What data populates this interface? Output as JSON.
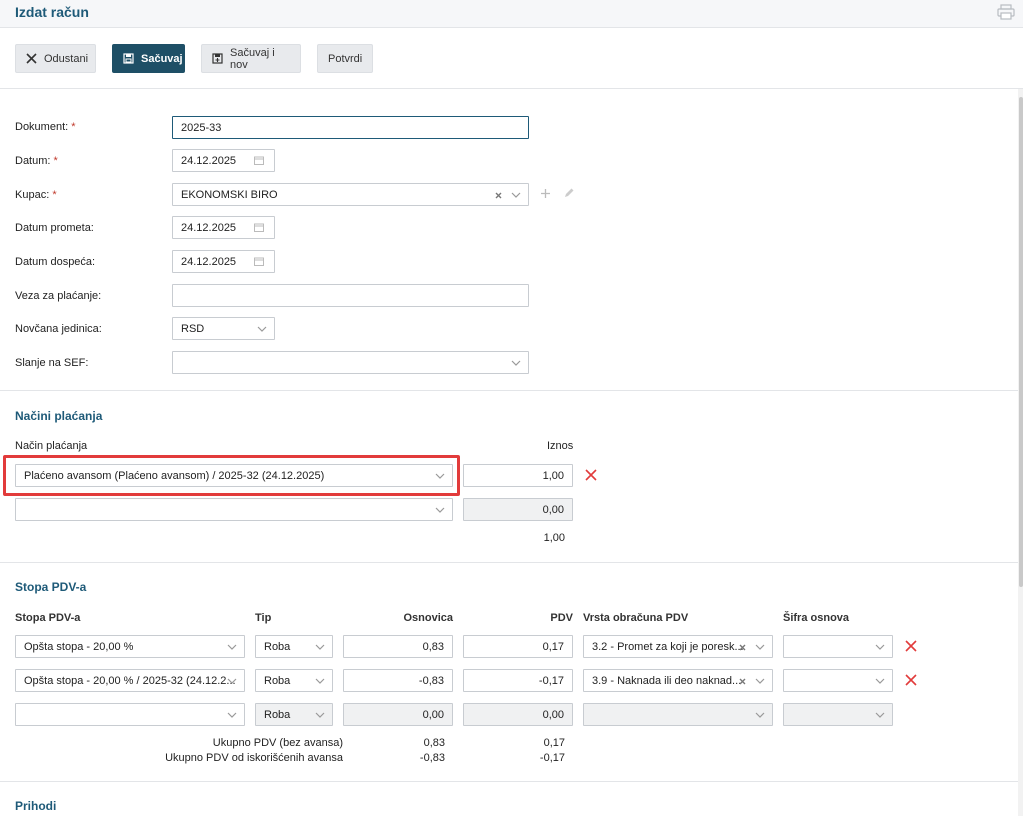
{
  "header": {
    "title": "Izdat račun"
  },
  "toolbar": {
    "cancel_label": "Odustani",
    "save_label": "Sačuvaj",
    "save_new_label": "Sačuvaj i nov",
    "confirm_label": "Potvrdi"
  },
  "form": {
    "dokument_label": "Dokument:",
    "dokument_value": "2025-33",
    "datum_label": "Datum:",
    "datum_value": "24.12.2025",
    "kupac_label": "Kupac:",
    "kupac_value": "EKONOMSKI BIRO",
    "datum_prometa_label": "Datum prometa:",
    "datum_prometa_value": "24.12.2025",
    "datum_dospeca_label": "Datum dospeća:",
    "datum_dospeca_value": "24.12.2025",
    "veza_label": "Veza za plaćanje:",
    "veza_value": "",
    "valuta_label": "Novčana jedinica:",
    "valuta_value": "RSD",
    "sef_label": "Slanje na SEF:",
    "sef_value": "",
    "required_mark": "*"
  },
  "payments": {
    "title": "Načini plaćanja",
    "col_method": "Način plaćanja",
    "col_amount": "Iznos",
    "rows": [
      {
        "method": "Plaćeno avansom (Plaćeno avansom) / 2025-32 (24.12.2025)",
        "amount": "1,00"
      },
      {
        "method": "",
        "amount": "0,00"
      }
    ],
    "total": "1,00"
  },
  "vat": {
    "title": "Stopa PDV-a",
    "col_rate": "Stopa PDV-a",
    "col_type": "Tip",
    "col_base": "Osnovica",
    "col_vat": "PDV",
    "col_calc": "Vrsta obračuna PDV",
    "col_code": "Šifra osnova",
    "rows": [
      {
        "rate": "Opšta stopa - 20,00 %",
        "type": "Roba",
        "base": "0,83",
        "vat": "0,17",
        "calc": "3.2 - Promet za koji je poresk...",
        "code": ""
      },
      {
        "rate": "Opšta stopa - 20,00 % / 2025-32 (24.12.2...",
        "type": "Roba",
        "base": "-0,83",
        "vat": "-0,17",
        "calc": "3.9 - Naknada ili deo naknad...",
        "code": ""
      },
      {
        "rate": "",
        "type": "Roba",
        "base": "0,00",
        "vat": "0,00",
        "calc": "",
        "code": ""
      }
    ],
    "sum1_label": "Ukupno PDV (bez avansa)",
    "sum1_base": "0,83",
    "sum1_vat": "0,17",
    "sum2_label": "Ukupno PDV od iskorišćenih avansa",
    "sum2_base": "-0,83",
    "sum2_vat": "-0,17"
  },
  "prihodi": {
    "title": "Prihodi"
  },
  "colors": {
    "accent": "#1e5a78",
    "primary_button": "#1e4f66",
    "danger": "#e23b3b"
  }
}
